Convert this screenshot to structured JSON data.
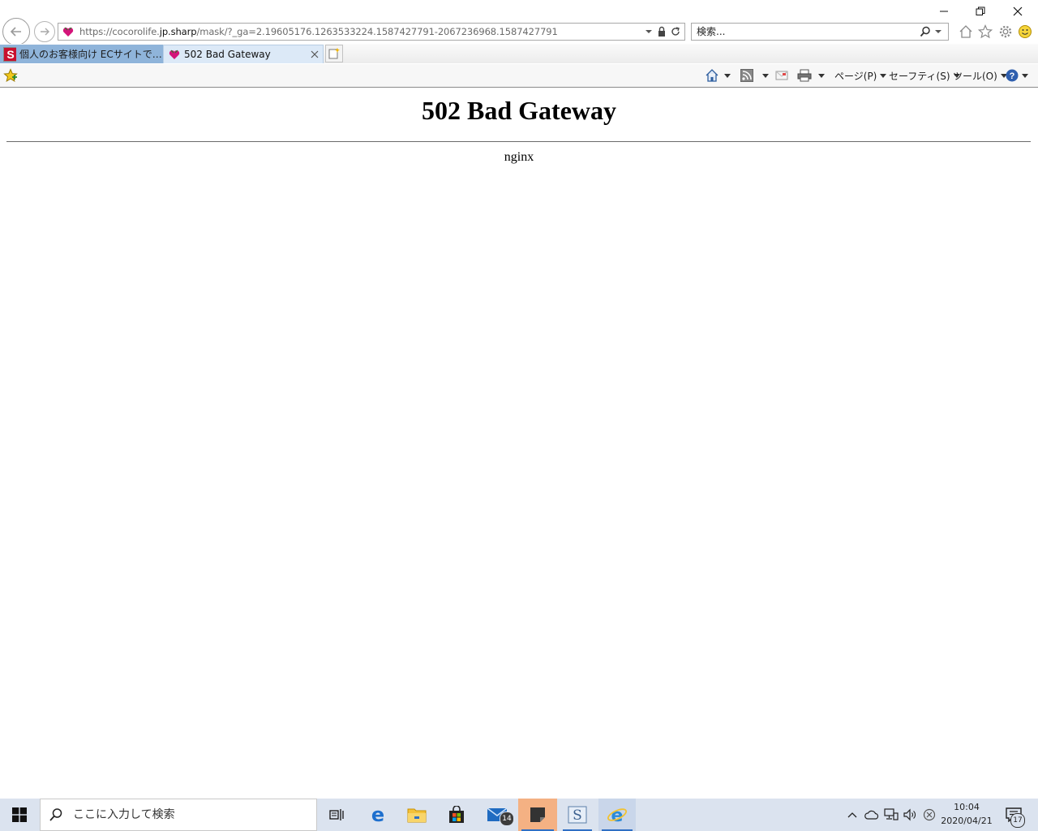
{
  "window": {
    "controls": [
      "minimize",
      "restore",
      "close"
    ]
  },
  "browser": {
    "address": {
      "prefix": "https://cocorolife.",
      "domain": "jp.sharp",
      "path": "/mask/?_ga=2.19605176.1263533224.1587427791-2067236968.1587427791"
    },
    "search": {
      "placeholder": "検索..."
    },
    "tabs": [
      {
        "label": "個人のお客様向け ECサイトでのマ...",
        "icon": "sharp-s-icon",
        "active": false
      },
      {
        "label": "502 Bad Gateway",
        "icon": "heart-favicon-icon",
        "active": true
      }
    ],
    "command_bar": {
      "page": "ページ(P)",
      "safety": "セーフティ(S)",
      "tools": "ツール(O)"
    },
    "colors": {
      "tab_inactive": "#8fb4da",
      "tab_active": "#dce9f7",
      "favicon": "#d4147a"
    }
  },
  "page": {
    "title": "502 Bad Gateway",
    "server": "nginx"
  },
  "taskbar": {
    "search_placeholder": "ここに入力して検索",
    "mail_badge": "14",
    "notification_badge": "17",
    "clock": {
      "time": "10:04",
      "date": "2020/04/21"
    },
    "colors": {
      "background": "#dbe3ef",
      "sticky_active": "#f4b183"
    }
  }
}
